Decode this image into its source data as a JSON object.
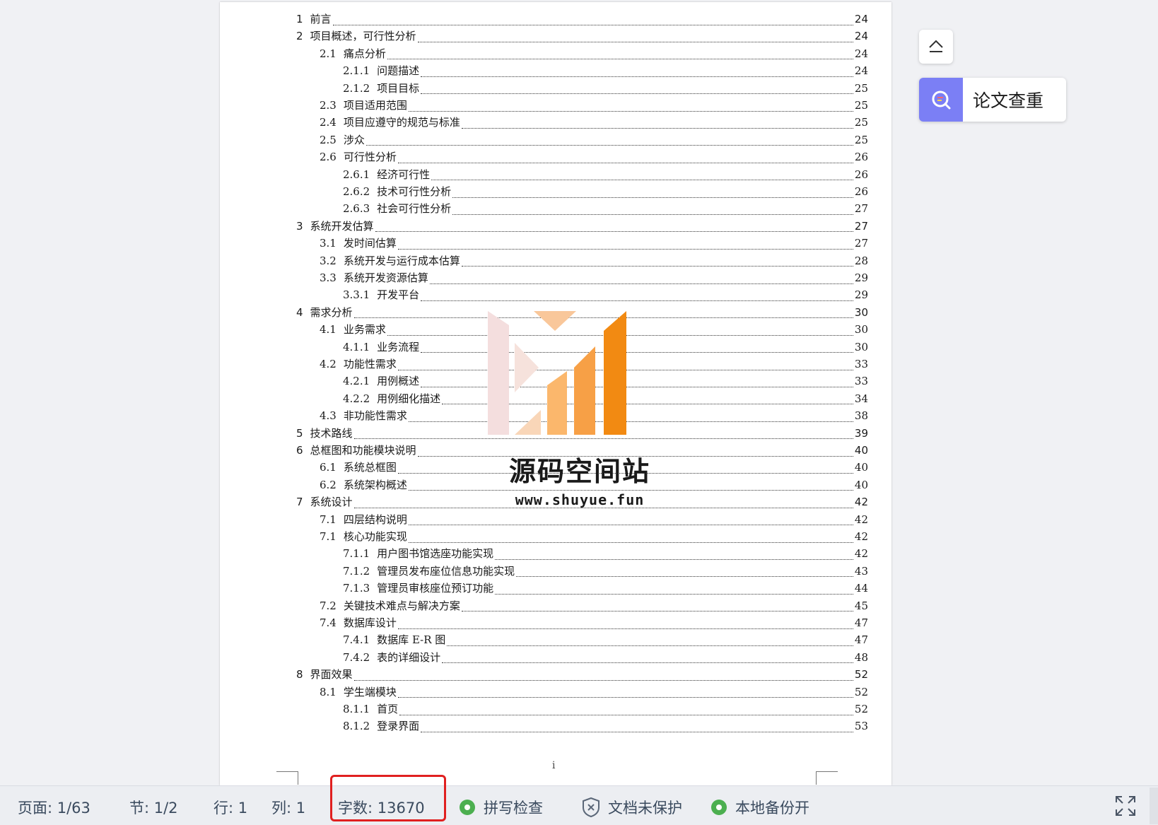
{
  "toc": [
    {
      "num": "1",
      "title": "前言",
      "page": "24",
      "level": 1
    },
    {
      "num": "2",
      "title": "项目概述，可行性分析",
      "page": "24",
      "level": 1
    },
    {
      "num": "2.1",
      "title": "痛点分析",
      "page": "24",
      "level": 2
    },
    {
      "num": "2.1.1",
      "title": "问题描述",
      "page": "24",
      "level": 3
    },
    {
      "num": "2.1.2",
      "title": "项目目标",
      "page": "25",
      "level": 3
    },
    {
      "num": "2.3",
      "title": "项目适用范围",
      "page": "25",
      "level": 2
    },
    {
      "num": "2.4",
      "title": "项目应遵守的规范与标准",
      "page": "25",
      "level": 2
    },
    {
      "num": "2.5",
      "title": "涉众",
      "page": "25",
      "level": 2
    },
    {
      "num": "2.6",
      "title": "可行性分析",
      "page": "26",
      "level": 2
    },
    {
      "num": "2.6.1",
      "title": "经济可行性",
      "page": "26",
      "level": 3
    },
    {
      "num": "2.6.2",
      "title": "技术可行性分析",
      "page": "26",
      "level": 3
    },
    {
      "num": "2.6.3",
      "title": "社会可行性分析",
      "page": "27",
      "level": 3
    },
    {
      "num": "3",
      "title": "系统开发估算",
      "page": "27",
      "level": 1
    },
    {
      "num": "3.1",
      "title": "发时间估算",
      "page": "27",
      "level": 2
    },
    {
      "num": "3.2",
      "title": "系统开发与运行成本估算",
      "page": "28",
      "level": 2
    },
    {
      "num": "3.3",
      "title": "系统开发资源估算",
      "page": "29",
      "level": 2
    },
    {
      "num": "3.3.1",
      "title": "开发平台",
      "page": "29",
      "level": 3
    },
    {
      "num": "4",
      "title": "需求分析",
      "page": "30",
      "level": 1
    },
    {
      "num": "4.1",
      "title": "业务需求",
      "page": "30",
      "level": 2
    },
    {
      "num": "4.1.1",
      "title": "业务流程",
      "page": "30",
      "level": 3
    },
    {
      "num": "4.2",
      "title": "功能性需求",
      "page": "33",
      "level": 2
    },
    {
      "num": "4.2.1",
      "title": "用例概述",
      "page": "33",
      "level": 3
    },
    {
      "num": "4.2.2",
      "title": "用例细化描述",
      "page": "34",
      "level": 3
    },
    {
      "num": "4.3",
      "title": "非功能性需求",
      "page": "38",
      "level": 2
    },
    {
      "num": "5",
      "title": "技术路线",
      "page": "39",
      "level": 1
    },
    {
      "num": "6",
      "title": "总框图和功能模块说明",
      "page": "40",
      "level": 1
    },
    {
      "num": "6.1",
      "title": "系统总框图",
      "page": "40",
      "level": 2
    },
    {
      "num": "6.2",
      "title": "系统架构概述",
      "page": "40",
      "level": 2
    },
    {
      "num": "7",
      "title": "系统设计",
      "page": "42",
      "level": 1
    },
    {
      "num": "7.1",
      "title": "四层结构说明",
      "page": "42",
      "level": 2
    },
    {
      "num": "7.1",
      "title": "核心功能实现",
      "page": "42",
      "level": 2
    },
    {
      "num": "7.1.1",
      "title": "用户图书馆选座功能实现",
      "page": "42",
      "level": 3
    },
    {
      "num": "7.1.2",
      "title": "管理员发布座位信息功能实现",
      "page": "43",
      "level": 3
    },
    {
      "num": "7.1.3",
      "title": "管理员审核座位预订功能",
      "page": "44",
      "level": 3
    },
    {
      "num": "7.2",
      "title": "关键技术难点与解决方案",
      "page": "45",
      "level": 2
    },
    {
      "num": "7.4",
      "title": "数据库设计",
      "page": "47",
      "level": 2
    },
    {
      "num": "7.4.1",
      "title": "数据库 E-R 图",
      "page": "47",
      "level": 3
    },
    {
      "num": "7.4.2",
      "title": "表的详细设计",
      "page": "48",
      "level": 3
    },
    {
      "num": "8",
      "title": "界面效果",
      "page": "52",
      "level": 1
    },
    {
      "num": "8.1",
      "title": "学生端模块",
      "page": "52",
      "level": 2
    },
    {
      "num": "8.1.1",
      "title": "首页",
      "page": "52",
      "level": 3
    },
    {
      "num": "8.1.2",
      "title": "登录界面",
      "page": "53",
      "level": 3
    }
  ],
  "page_footer_number": "i",
  "watermark": {
    "title": "源码空间站",
    "url": "www.shuyue.fun"
  },
  "tools": {
    "collapse_icon": "eject-icon",
    "check_label": "论文查重",
    "check_icon": "search-check-icon"
  },
  "statusbar": {
    "page": "页面: 1/63",
    "section": "节: 1/2",
    "row": "行: 1",
    "col": "列: 1",
    "wordcount": "字数: 13670",
    "spellcheck": "拼写检查",
    "protect": "文档未保护",
    "backup": "本地备份开"
  },
  "colors": {
    "accent": "#7b7ff5",
    "status_ok": "#4caf50",
    "highlight": "#e02020",
    "wm_orange": "#f28a12"
  }
}
